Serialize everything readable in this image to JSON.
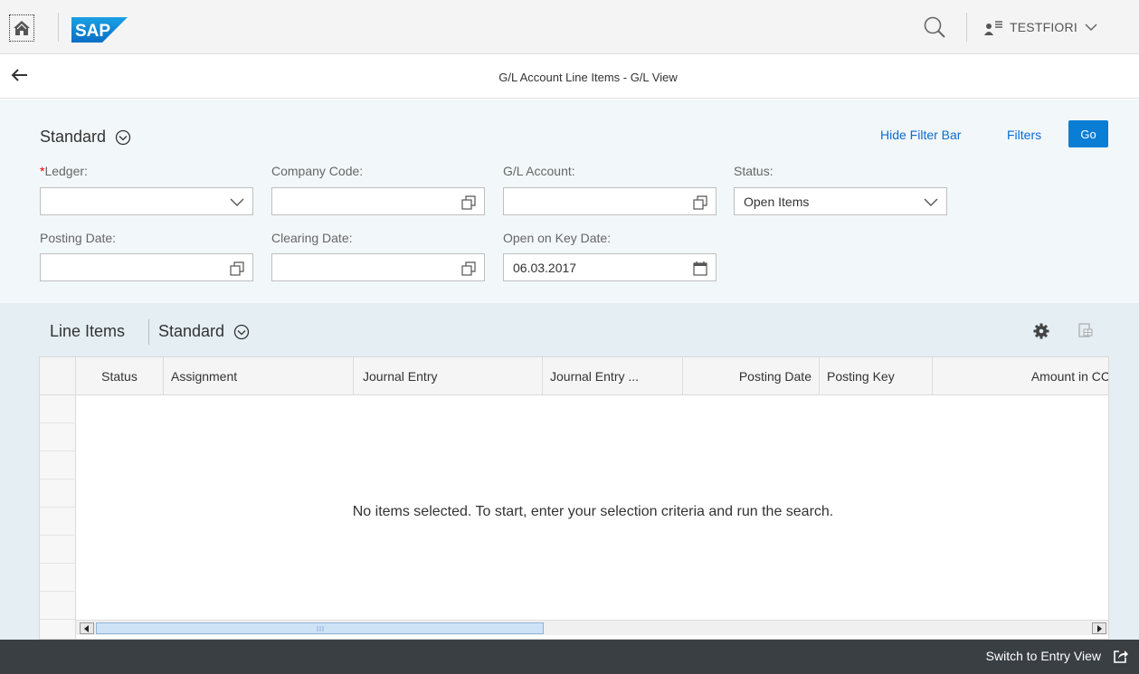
{
  "shell": {
    "logo_text": "SAP",
    "user_name": "TESTFIORI"
  },
  "header": {
    "title": "G/L Account Line Items - G/L View"
  },
  "filter_bar": {
    "variant": "Standard",
    "hide_filter_bar": "Hide Filter Bar",
    "filters": "Filters",
    "go": "Go",
    "fields": {
      "ledger": {
        "required_mark": "*",
        "label": "Ledger:",
        "value": ""
      },
      "company_code": {
        "label": "Company Code:",
        "value": ""
      },
      "gl_account": {
        "label": "G/L Account:",
        "value": ""
      },
      "status": {
        "label": "Status:",
        "value": "Open Items"
      },
      "posting_date": {
        "label": "Posting Date:",
        "value": ""
      },
      "clearing_date": {
        "label": "Clearing Date:",
        "value": ""
      },
      "open_on_key_date": {
        "label": "Open on Key Date:",
        "value": "06.03.2017"
      }
    }
  },
  "table": {
    "title": "Line Items",
    "variant": "Standard",
    "columns": [
      "Status",
      "Assignment",
      "Journal Entry",
      "Journal Entry ...",
      "Posting Date",
      "Posting Key",
      "Amount in CC"
    ],
    "empty_message": "No items selected. To start, enter your selection criteria and run the search.",
    "scroll_position": 0,
    "scroll_visible_fraction": 0.45
  },
  "footer": {
    "switch_view": "Switch to Entry View"
  },
  "colors": {
    "accent": "#0a6ed1",
    "go_button": "#0a7dd4",
    "footer_bg": "#3a3f44",
    "filter_bg": "#f2f7fa",
    "table_section_bg": "#e5eef3"
  }
}
